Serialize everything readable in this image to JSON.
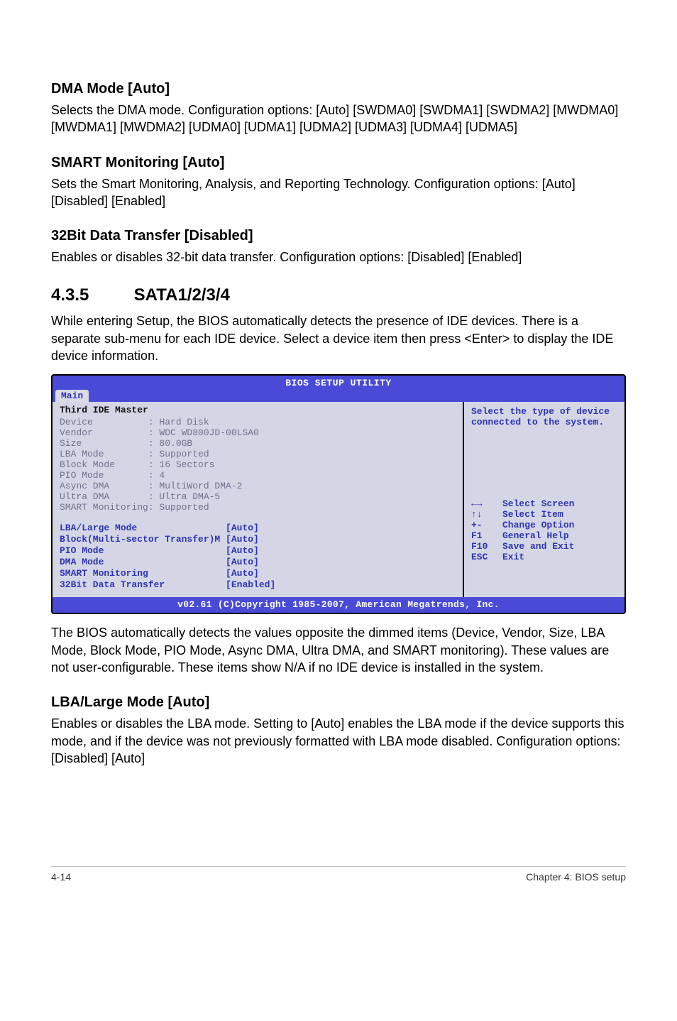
{
  "sections": {
    "dma": {
      "heading": "DMA Mode [Auto]",
      "body": "Selects the DMA mode. Configuration options: [Auto] [SWDMA0] [SWDMA1] [SWDMA2] [MWDMA0] [MWDMA1] [MWDMA2] [UDMA0] [UDMA1] [UDMA2] [UDMA3] [UDMA4] [UDMA5]"
    },
    "smart": {
      "heading": "SMART Monitoring [Auto]",
      "body": "Sets the Smart Monitoring, Analysis, and Reporting Technology. Configuration options: [Auto] [Disabled] [Enabled]"
    },
    "tx32": {
      "heading": "32Bit Data Transfer [Disabled]",
      "body": "Enables or disables 32-bit data transfer. Configuration options: [Disabled] [Enabled]"
    },
    "sata": {
      "num": "4.3.5",
      "title": "SATA1/2/3/4",
      "intro": "While entering Setup, the BIOS automatically detects the presence of IDE devices. There is a separate sub-menu for each IDE device. Select a device item then press <Enter> to display the IDE device information."
    },
    "after_bios": {
      "para": "The BIOS automatically detects the values opposite the dimmed items (Device, Vendor, Size, LBA Mode, Block Mode, PIO Mode, Async DMA, Ultra DMA, and SMART monitoring). These values are not user-configurable. These items show N/A if no IDE device is installed in the system."
    },
    "lba": {
      "heading": "LBA/Large Mode [Auto]",
      "body": "Enables or disables the LBA mode. Setting to [Auto] enables the LBA mode if the device supports this mode, and if the device was not previously formatted with LBA mode disabled. Configuration options: [Disabled] [Auto]"
    }
  },
  "bios": {
    "header": "BIOS SETUP UTILITY",
    "tab": "Main",
    "left_title": "Third IDE Master",
    "info": [
      {
        "label": "Device",
        "value": ": Hard Disk"
      },
      {
        "label": "Vendor",
        "value": ": WDC WD800JD-00LSA0"
      },
      {
        "label": "Size",
        "value": ": 80.0GB"
      },
      {
        "label": "LBA Mode",
        "value": ": Supported"
      },
      {
        "label": "Block Mode",
        "value": ": 16 Sectors"
      },
      {
        "label": "PIO Mode",
        "value": ": 4"
      },
      {
        "label": "Async DMA",
        "value": ": MultiWord DMA-2"
      },
      {
        "label": "Ultra DMA",
        "value": ": Ultra DMA-5"
      },
      {
        "label": "SMART Monitoring",
        "value": ": Supported"
      }
    ],
    "config": [
      {
        "label": "LBA/Large Mode",
        "value": "[Auto]"
      },
      {
        "label": "Block(Multi-sector Transfer)M",
        "value": "[Auto]"
      },
      {
        "label": "PIO Mode",
        "value": "[Auto]"
      },
      {
        "label": "DMA Mode",
        "value": "[Auto]"
      },
      {
        "label": "SMART Monitoring",
        "value": "[Auto]"
      },
      {
        "label": "32Bit Data Transfer",
        "value": "[Enabled]"
      }
    ],
    "help_title": "Select the type of device connected to the system.",
    "nav": [
      {
        "key": "←→",
        "text": "Select Screen"
      },
      {
        "key": "↑↓",
        "text": "Select Item"
      },
      {
        "key": "+-",
        "text": "Change Option"
      },
      {
        "key": "F1",
        "text": "General Help"
      },
      {
        "key": "F10",
        "text": "Save and Exit"
      },
      {
        "key": "ESC",
        "text": "Exit"
      }
    ],
    "copyright": "v02.61 (C)Copyright 1985-2007, American Megatrends, Inc."
  },
  "footer": {
    "left": "4-14",
    "right": "Chapter 4: BIOS setup"
  }
}
